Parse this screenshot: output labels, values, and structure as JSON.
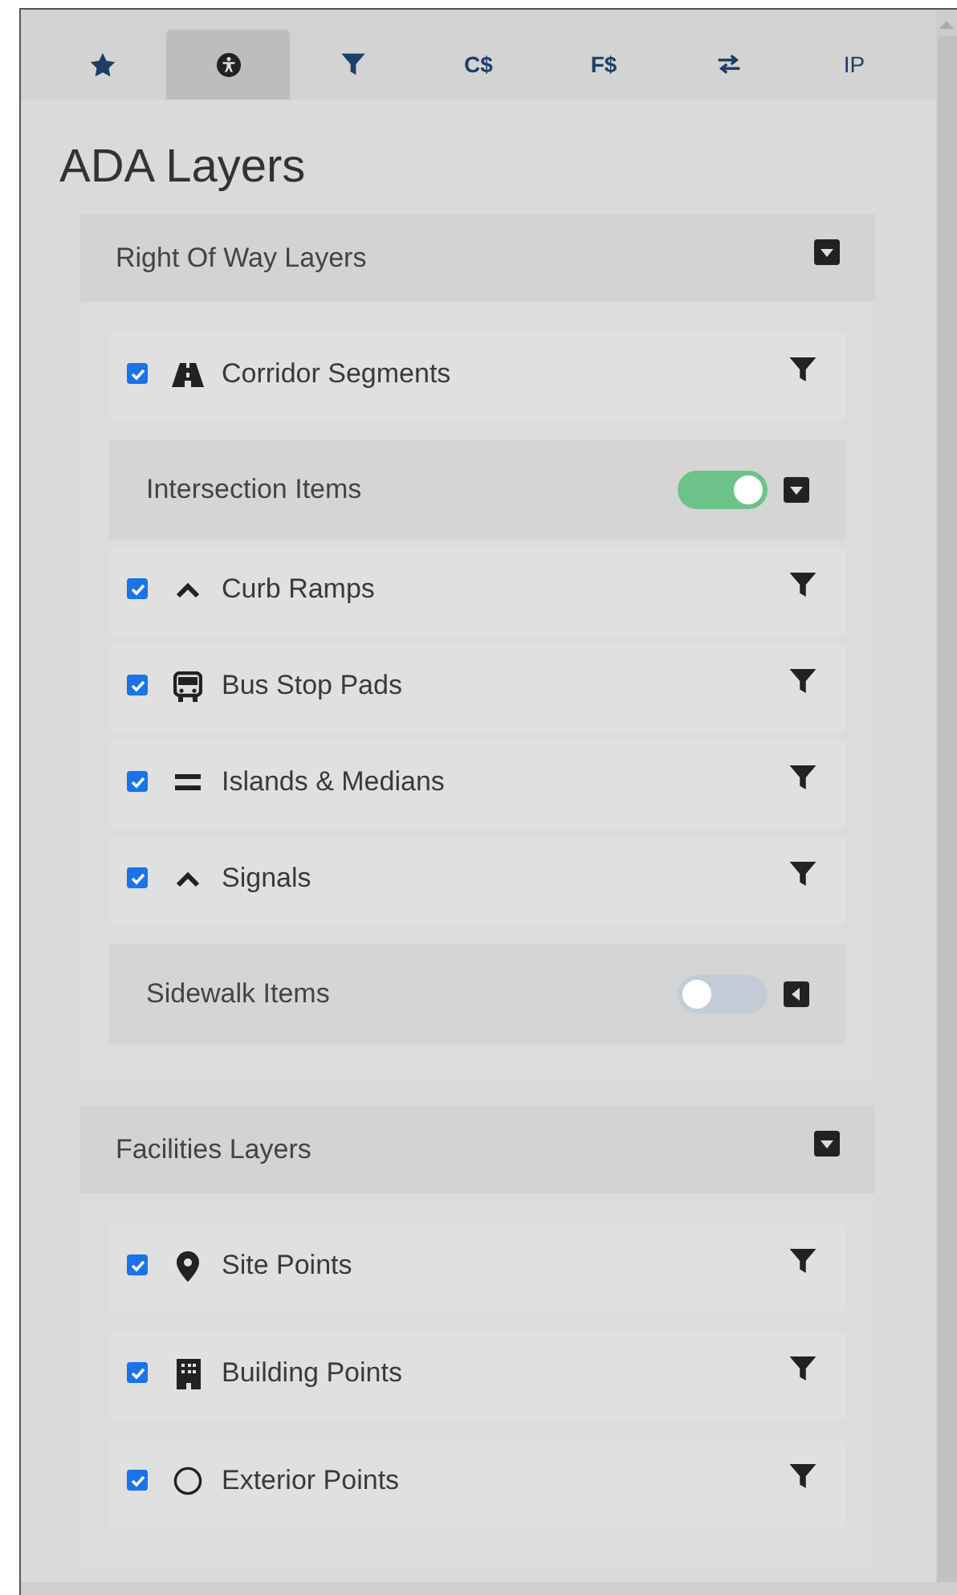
{
  "tabs": [
    {
      "kind": "star",
      "selected": false
    },
    {
      "kind": "accessibility",
      "selected": true
    },
    {
      "kind": "filter",
      "selected": false
    },
    {
      "kind": "text",
      "label": "C$",
      "selected": false
    },
    {
      "kind": "text",
      "label": "F$",
      "selected": false
    },
    {
      "kind": "swap",
      "selected": false
    },
    {
      "kind": "text",
      "label": "IP",
      "selected": false
    }
  ],
  "title": "ADA Layers",
  "sections": [
    {
      "title": "Right Of Way Layers",
      "expanded": true,
      "items": [
        {
          "kind": "layer",
          "label": "Corridor Segments",
          "checked": true
        },
        {
          "kind": "group",
          "label": "Intersection Items",
          "on": true,
          "expanded": true,
          "children": [
            {
              "label": "Curb Ramps",
              "checked": true
            },
            {
              "label": "Bus Stop Pads",
              "checked": true
            },
            {
              "label": "Islands & Medians",
              "checked": true
            },
            {
              "label": "Signals",
              "checked": true
            }
          ]
        },
        {
          "kind": "group",
          "label": "Sidewalk Items",
          "on": false,
          "expanded": false
        }
      ]
    },
    {
      "title": "Facilities Layers",
      "expanded": true,
      "items": [
        {
          "kind": "layer",
          "label": "Site Points",
          "checked": true
        },
        {
          "kind": "layer",
          "label": "Building Points",
          "checked": true
        },
        {
          "kind": "layer",
          "label": "Exterior Points",
          "checked": true
        }
      ]
    }
  ]
}
